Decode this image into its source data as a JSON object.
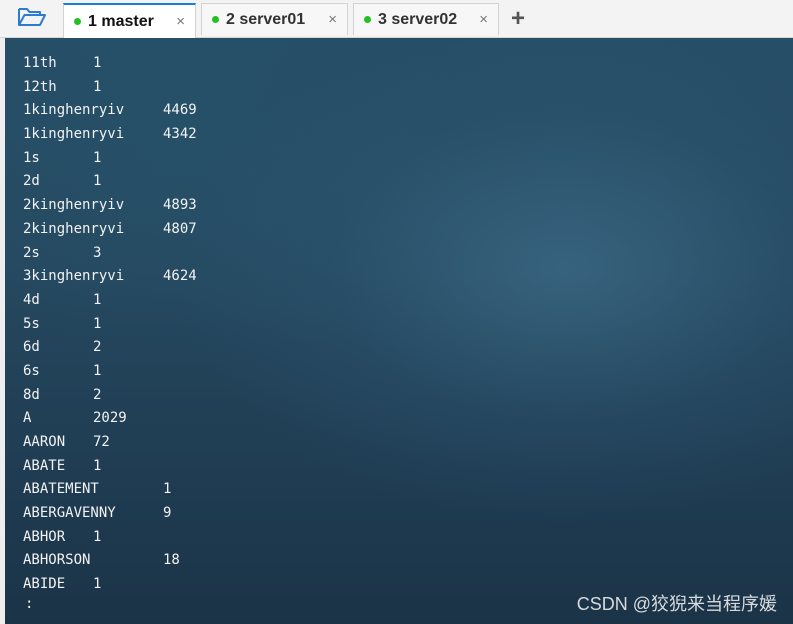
{
  "tabs": [
    {
      "number": "1",
      "label": "1 master",
      "active": true,
      "status_color": "#21c121"
    },
    {
      "number": "2",
      "label": "2 server01",
      "active": false,
      "status_color": "#21c121"
    },
    {
      "number": "3",
      "label": "3 server02",
      "active": false,
      "status_color": "#21c121"
    }
  ],
  "tab_close_glyph": "×",
  "add_tab_glyph": "+",
  "icons": {
    "open_session": "folder-open-icon",
    "close_tab": "close-icon",
    "add_tab": "plus-icon"
  },
  "terminal": {
    "output": [
      {
        "word": "11th",
        "count": "1"
      },
      {
        "word": "12th",
        "count": "1"
      },
      {
        "word": "1kinghenryiv",
        "count": "4469"
      },
      {
        "word": "1kinghenryvi",
        "count": "4342"
      },
      {
        "word": "1s",
        "count": "1"
      },
      {
        "word": "2d",
        "count": "1"
      },
      {
        "word": "2kinghenryiv",
        "count": "4893"
      },
      {
        "word": "2kinghenryvi",
        "count": "4807"
      },
      {
        "word": "2s",
        "count": "3"
      },
      {
        "word": "3kinghenryvi",
        "count": "4624"
      },
      {
        "word": "4d",
        "count": "1"
      },
      {
        "word": "5s",
        "count": "1"
      },
      {
        "word": "6d",
        "count": "2"
      },
      {
        "word": "6s",
        "count": "1"
      },
      {
        "word": "8d",
        "count": "2"
      },
      {
        "word": "A",
        "count": "2029"
      },
      {
        "word": "AARON",
        "count": "72"
      },
      {
        "word": "ABATE",
        "count": "1"
      },
      {
        "word": "ABATEMENT",
        "count": "1"
      },
      {
        "word": "ABERGAVENNY",
        "count": "9"
      },
      {
        "word": "ABHOR",
        "count": "1"
      },
      {
        "word": "ABHORSON",
        "count": "18"
      },
      {
        "word": "ABIDE",
        "count": "1"
      }
    ],
    "prompt": ":"
  },
  "watermark": "CSDN @狡猊来当程序媛",
  "colors": {
    "active_tab_accent": "#1a7fd8",
    "terminal_text": "#f2f2f2",
    "terminal_bg": "#25485f"
  }
}
